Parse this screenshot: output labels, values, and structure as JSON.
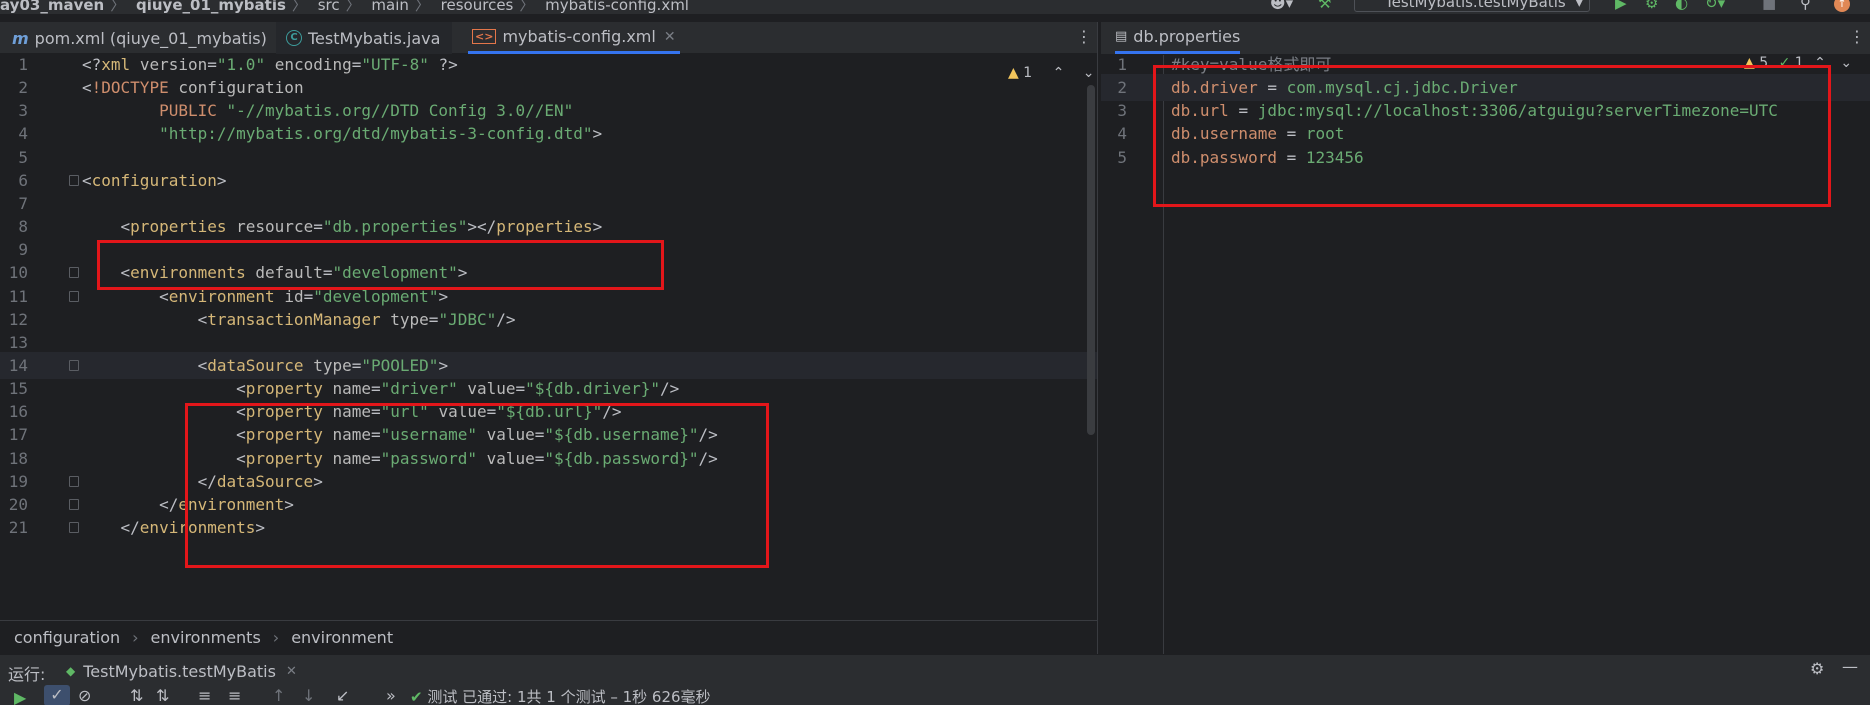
{
  "top_breadcrumb": [
    "ay03_maven",
    "qiuye_01_mybatis",
    "src",
    "main",
    "resources",
    "mybatis-config.xml"
  ],
  "toolbar": {
    "run_config": "TestMybatis.testMyBatis"
  },
  "left_tabs": [
    {
      "label": "pom.xml (qiuye_01_mybatis)",
      "icon": "m"
    },
    {
      "label": "TestMybatis.java",
      "icon": "c"
    },
    {
      "label": "mybatis-config.xml",
      "icon": "xml",
      "active": true
    }
  ],
  "right_tabs": [
    {
      "label": "db.properties",
      "active": true
    }
  ],
  "left_inspection": {
    "warnings": "1"
  },
  "right_inspection": {
    "warnings": "5",
    "ok": "1"
  },
  "left_editor": {
    "line_numbers": [
      "1",
      "2",
      "3",
      "4",
      "5",
      "6",
      "7",
      "8",
      "9",
      "10",
      "11",
      "12",
      "13",
      "14",
      "15",
      "16",
      "17",
      "18",
      "19",
      "20",
      "21"
    ],
    "lines": [
      "<?xml version=\"1.0\" encoding=\"UTF-8\" ?>",
      "<!DOCTYPE configuration",
      "        PUBLIC \"-//mybatis.org//DTD Config 3.0//EN\"",
      "        \"http://mybatis.org/dtd/mybatis-3-config.dtd\">",
      "",
      "<configuration>",
      "",
      "    <properties resource=\"db.properties\"></properties>",
      "",
      "    <environments default=\"development\">",
      "        <environment id=\"development\">",
      "            <transactionManager type=\"JDBC\"/>",
      "",
      "            <dataSource type=\"POOLED\">",
      "                <property name=\"driver\" value=\"${db.driver}\"/>",
      "                <property name=\"url\" value=\"${db.url}\"/>",
      "                <property name=\"username\" value=\"${db.username}\"/>",
      "                <property name=\"password\" value=\"${db.password}\"/>",
      "            </dataSource>",
      "        </environment>",
      "    </environments>"
    ]
  },
  "right_editor": {
    "line_numbers": [
      "1",
      "2",
      "3",
      "4",
      "5"
    ],
    "lines": [
      "#key=value格式即可",
      "db.driver = com.mysql.cj.jdbc.Driver",
      "db.url = jdbc:mysql://localhost:3306/atguigu?serverTimezone=UTC",
      "db.username = root",
      "db.password = 123456"
    ]
  },
  "bottom_breadcrumb": [
    "configuration",
    "environments",
    "environment"
  ],
  "run_panel": {
    "label": "运行:",
    "tab": "TestMybatis.testMyBatis",
    "status": "测试 已通过: 1共 1 个测试 – 1秒 626毫秒"
  },
  "colors": {
    "tag": "#d5b778",
    "attr": "#bababa",
    "string": "#6aab73",
    "keyword": "#cf8e6d",
    "highlight_box": "#e3161a"
  }
}
